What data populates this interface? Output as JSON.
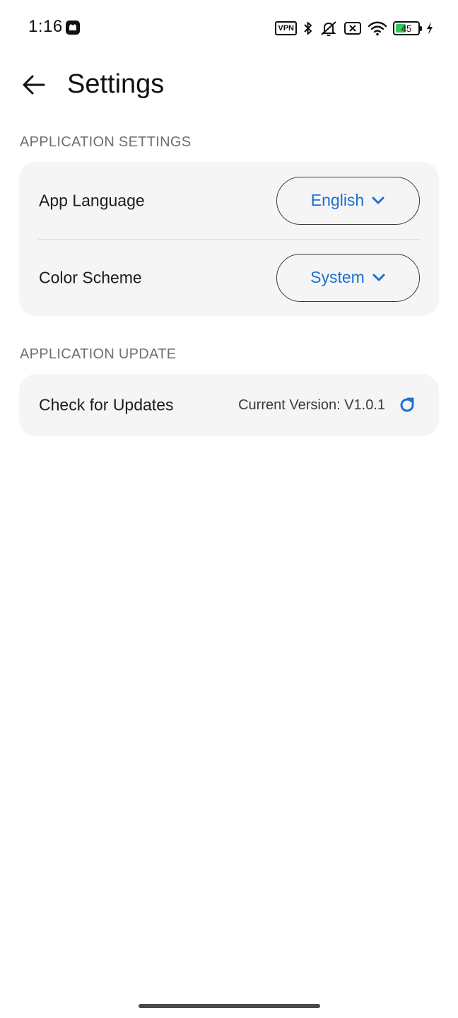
{
  "status_bar": {
    "time": "1:16",
    "vpn_label": "VPN",
    "battery_percent": 45,
    "battery_label": "45",
    "icons": [
      "app-notification-icon",
      "vpn-icon",
      "bluetooth-icon",
      "muted-bell-icon",
      "no-sim-icon",
      "wifi-icon",
      "battery-icon",
      "charging-bolt-icon"
    ]
  },
  "header": {
    "title": "Settings",
    "back_icon": "arrow-left-icon"
  },
  "sections": {
    "application_settings": {
      "label": "APPLICATION SETTINGS",
      "rows": [
        {
          "label": "App Language",
          "value": "English"
        },
        {
          "label": "Color Scheme",
          "value": "System"
        }
      ]
    },
    "application_update": {
      "label": "APPLICATION UPDATE",
      "row": {
        "label": "Check for Updates",
        "version_text": "Current Version: V1.0.1",
        "action_icon": "refresh-icon"
      }
    }
  },
  "colors": {
    "accent": "#1e6fd0",
    "card_background": "#f5f5f5",
    "section_label": "#6e6e73",
    "battery_green": "#34c759"
  }
}
